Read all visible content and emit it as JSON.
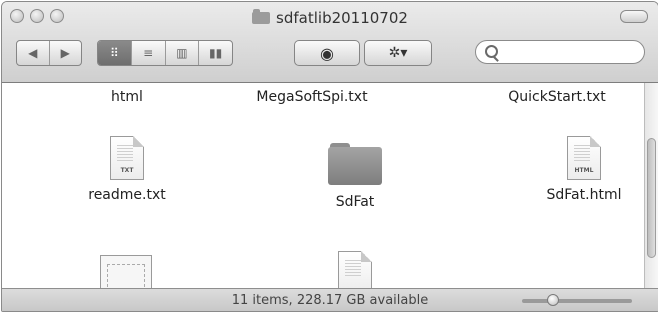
{
  "window": {
    "title": "sdfatlib20110702"
  },
  "toolbar": {
    "nav": [
      "◀",
      "▶"
    ],
    "view_icons": [
      "icon-view-icon",
      "list-view-icon",
      "column-view-icon",
      "coverflow-view-icon"
    ],
    "view_glyphs": [
      "⠿",
      "≡",
      "▥",
      "▮▮"
    ],
    "active_view": 0,
    "quicklook_glyph": "◉",
    "action_glyph": "✲▾",
    "search_placeholder": ""
  },
  "files": {
    "row1": [
      {
        "label": "html"
      },
      {
        "label": "MegaSoftSpi.txt"
      },
      {
        "label": "QuickStart.txt"
      }
    ],
    "row2": [
      {
        "label": "readme.txt",
        "icon_tag": "TXT"
      },
      {
        "label": "SdFat"
      },
      {
        "label": "SdFat.html",
        "icon_tag": "HTML"
      }
    ]
  },
  "status": {
    "text": "11 items, 228.17 GB available",
    "zoom_level": 0.25
  },
  "colors": {
    "toolbar_top": "#ebebeb",
    "toolbar_bottom": "#cfcfcf",
    "active_segment": "#7a7a7a",
    "folder": "#8f8f8f"
  }
}
